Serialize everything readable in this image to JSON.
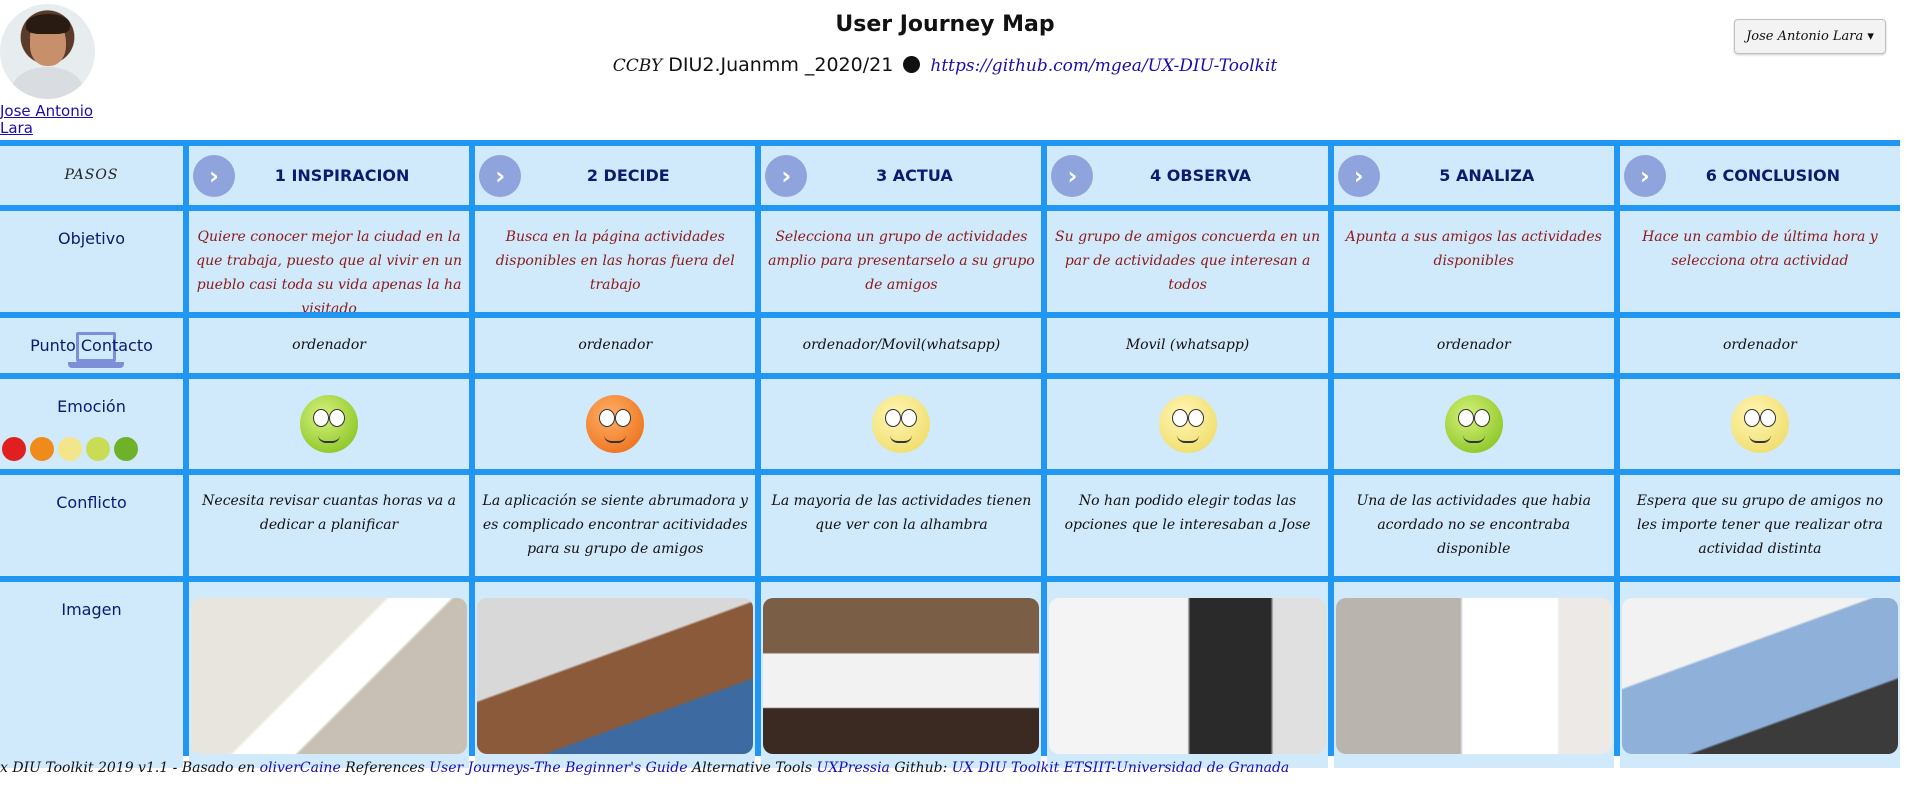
{
  "header": {
    "user_name": "Jose Antonio Lara",
    "title": "User Journey Map",
    "license": "CCBY",
    "course": "DIU2.Juanmm _2020/21",
    "repo_link": "https://github.com/mgea/UX-DIU-Toolkit",
    "user_button": "Jose Antonio Lara",
    "user_button_chevron": "▾"
  },
  "rows": {
    "steps": "PASOS",
    "objetivo": "Objetivo",
    "contacto": "Punto Contacto",
    "emocion": "Emoción",
    "conflicto": "Conflicto",
    "imagen": "Imagen"
  },
  "emotion_scale": [
    "#e02020",
    "#f08a1a",
    "#f3e68a",
    "#c8dd55",
    "#6fb22a"
  ],
  "steps": [
    {
      "title": "1 INSPIRACION",
      "objetivo": "Quiere conocer mejor la ciudad en la que trabaja, puesto que al vivir en un pueblo casi toda su vida apenas la ha visitado",
      "contacto": "ordenador",
      "emocion": "happy",
      "conflicto": "Necesita revisar cuantas horas va a dedicar a planificar"
    },
    {
      "title": "2 DECIDE",
      "objetivo": "Busca en la página actividades disponibles en las horas fuera del trabajo",
      "contacto": "ordenador",
      "emocion": "angry",
      "conflicto": "La aplicación se siente abrumadora y es complicado encontrar acitividades para su grupo de amigos"
    },
    {
      "title": "3 ACTUA",
      "objetivo": "Selecciona un grupo de actividades amplio para presentarselo a su grupo de amigos",
      "contacto": "ordenador/Movil(whatsapp)",
      "emocion": "neutral",
      "conflicto": "La mayoria de las actividades tienen que ver con la alhambra"
    },
    {
      "title": "4 OBSERVA",
      "objetivo": "Su grupo de amigos concuerda en un par de actividades que interesan a todos",
      "contacto": "Movil (whatsapp)",
      "emocion": "neutral",
      "conflicto": "No han podido elegir todas las opciones que le interesaban a Jose"
    },
    {
      "title": "5 ANALIZA",
      "objetivo": "Apunta a sus amigos las actividades disponibles",
      "contacto": "ordenador",
      "emocion": "happy",
      "conflicto": "Una de las actividades que habia acordado no se encontraba disponible"
    },
    {
      "title": "6 CONCLUSION",
      "objetivo": "Hace un cambio de última hora y selecciona otra actividad",
      "contacto": "ordenador",
      "emocion": "neutral",
      "conflicto": "Espera que su grupo de amigos no les importe tener que realizar otra actividad distinta"
    }
  ],
  "footer": {
    "prefix": "x DIU Toolkit 2019 v1.1 - Basado en ",
    "link1": "oliverCaine",
    "references": "   References ",
    "link2": "User Journeys-The Beginner's Guide",
    "alt_tools": "   Alternative Tools ",
    "link3": "UXPressia",
    "github": " Github: ",
    "link4": "UX DIU Toolkit",
    "link5": "ETSIIT-Universidad de Granada"
  }
}
